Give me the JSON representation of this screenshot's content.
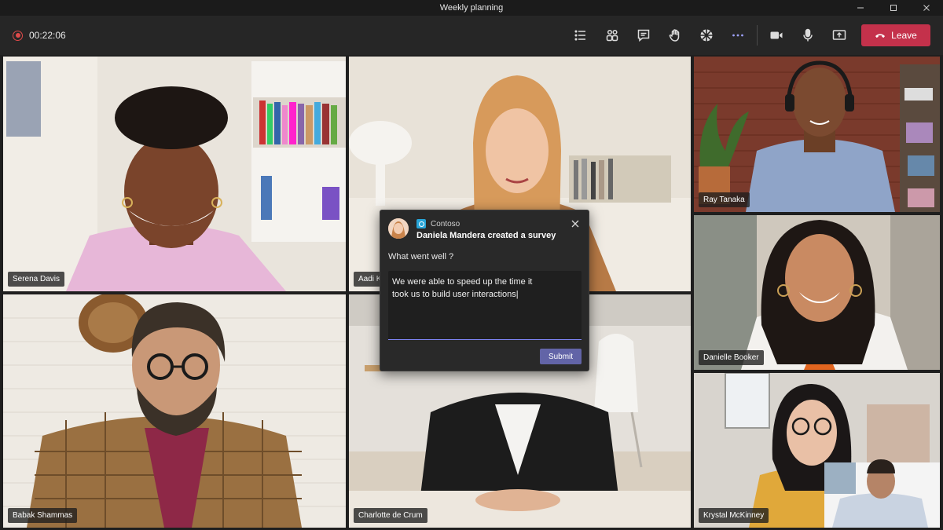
{
  "window": {
    "title": "Weekly planning"
  },
  "toolbar": {
    "timer": "00:22:06",
    "leave_label": "Leave"
  },
  "participants": [
    {
      "name": "Serena Davis"
    },
    {
      "name": "Aadi K"
    },
    {
      "name": "Ray Tanaka"
    },
    {
      "name": "Danielle Booker"
    },
    {
      "name": "Babak Shammas"
    },
    {
      "name": "Charlotte de Crum"
    },
    {
      "name": "Krystal McKinney"
    }
  ],
  "survey": {
    "app_name": "Contoso",
    "title": "Daniela Mandera created a survey",
    "question": "What went well ?",
    "answer_line1": "We were able to speed up the time it",
    "answer_line2": "took us to build user interactions|",
    "submit_label": "Submit"
  },
  "colors": {
    "leave": "#c4314b",
    "accent": "#6264a7",
    "record": "#e04a4a"
  }
}
